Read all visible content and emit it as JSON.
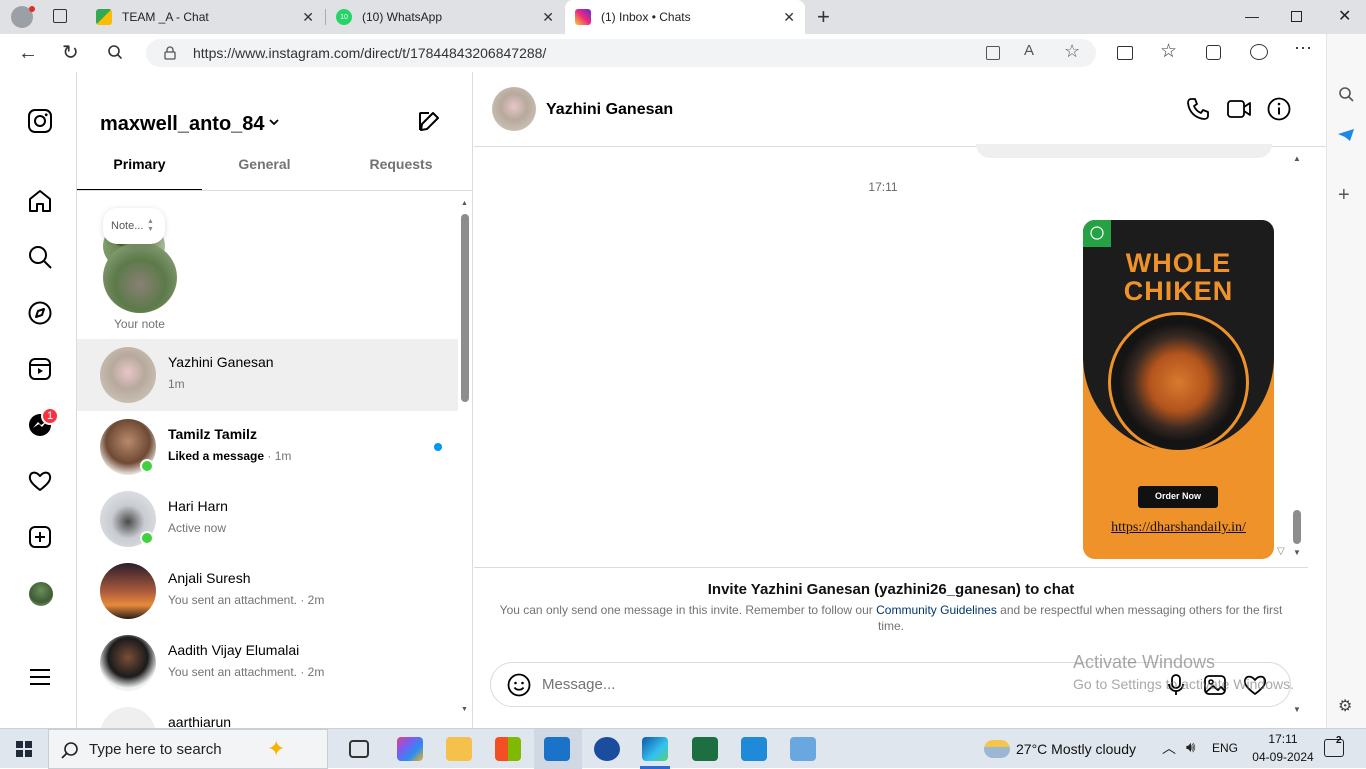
{
  "browser": {
    "tabs": [
      {
        "title": "TEAM _A - Chat",
        "active": false
      },
      {
        "title": "(10) WhatsApp",
        "active": false,
        "badge": "10"
      },
      {
        "title": "(1) Inbox • Chats",
        "active": true
      }
    ],
    "url": "https://www.instagram.com/direct/t/17844843206847288/"
  },
  "inbox": {
    "username": "maxwell_anto_84",
    "tabs": [
      "Primary",
      "General",
      "Requests"
    ],
    "note_bubble": "Note...",
    "your_note": "Your note",
    "messenger_badge": "1",
    "conversations": [
      {
        "name": "Yazhini Ganesan",
        "sub": "1m",
        "bold": false,
        "online": false,
        "selected": true
      },
      {
        "name": "Tamilz Tamilz",
        "sub_bold": "Liked a message",
        "sub": " · 1m",
        "bold": true,
        "online": true,
        "unread": true
      },
      {
        "name": "Hari Harn",
        "sub": "Active now",
        "bold": false,
        "online": true
      },
      {
        "name": "Anjali Suresh",
        "sub": "You sent an attachment. · 2m",
        "bold": false,
        "online": false
      },
      {
        "name": "Aadith Vijay Elumalai",
        "sub": "You sent an attachment. · 2m",
        "bold": false,
        "online": false
      },
      {
        "name": "aarthiarun",
        "sub": "",
        "bold": false,
        "online": false
      }
    ]
  },
  "chat": {
    "contact_name": "Yazhini Ganesan",
    "timestamp": "17:11",
    "poster": {
      "line1": "WHOLE",
      "line2": "CHIKEN",
      "button": "Order Now",
      "link": "https://dharshandaily.in/"
    },
    "invite_title": "Invite Yazhini Ganesan (yazhini26_ganesan) to chat",
    "invite_text_1": "You can only send one message in this invite. Remember to follow our ",
    "invite_link": "Community Guidelines",
    "invite_text_2": " and be respectful when messaging others for the first time.",
    "message_placeholder": "Message...",
    "watermark_1": "Activate Windows",
    "watermark_2": "Go to Settings to activate Windows."
  },
  "taskbar": {
    "search_placeholder": "Type here to search",
    "weather": "27°C  Mostly cloudy",
    "lang": "ENG",
    "time": "17:11",
    "date": "04-09-2024",
    "notif_count": "2"
  },
  "colors": {
    "ig_blue": "#0095f6",
    "link_blue": "#00376b",
    "online_green": "#3fd13f",
    "poster_orange": "#f0922a",
    "poster_dark": "#1c1c1c"
  }
}
